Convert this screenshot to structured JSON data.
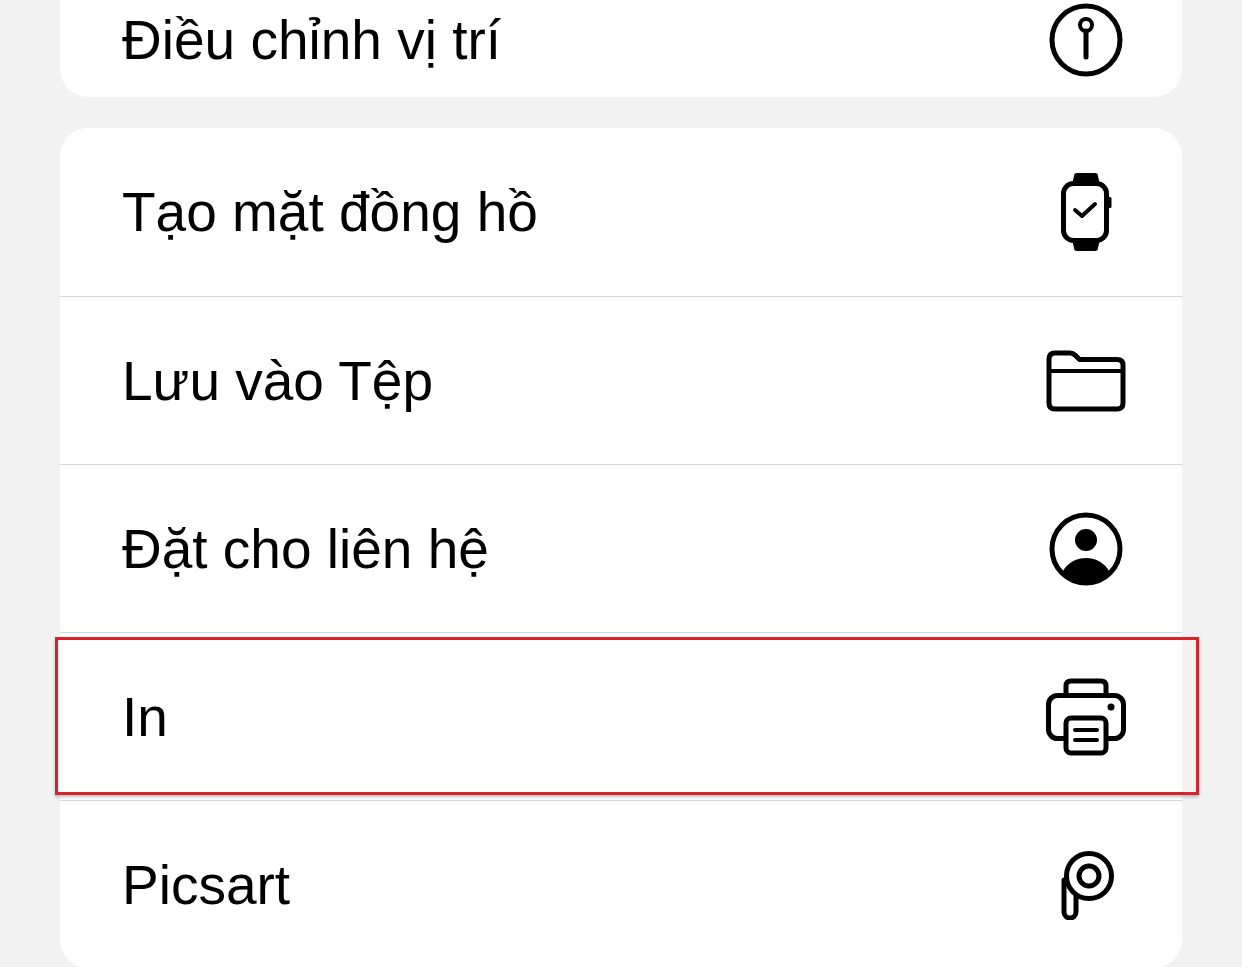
{
  "sections": [
    {
      "items": [
        {
          "label": "Điều chỉnh vị trí",
          "kind": "location",
          "highlighted": false
        }
      ]
    },
    {
      "items": [
        {
          "label": "Tạo mặt đồng hồ",
          "kind": "watch-face",
          "highlighted": false
        },
        {
          "label": "Lưu vào Tệp",
          "kind": "files",
          "highlighted": false
        },
        {
          "label": "Đặt cho liên hệ",
          "kind": "contact",
          "highlighted": false
        },
        {
          "label": "In",
          "kind": "print",
          "highlighted": true
        },
        {
          "label": "Picsart",
          "kind": "app",
          "highlighted": false
        }
      ]
    }
  ]
}
